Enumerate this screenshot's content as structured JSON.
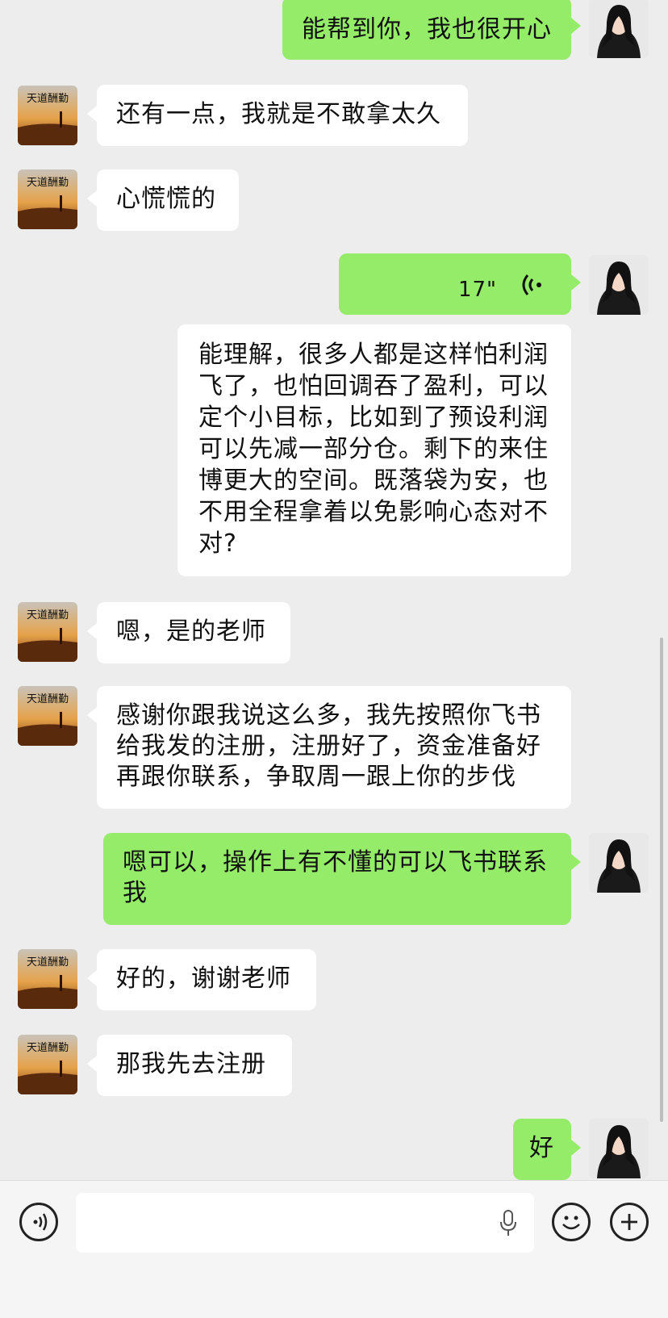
{
  "messages": [
    {
      "side": "right",
      "text": "能帮到你，我也很开心"
    },
    {
      "side": "left",
      "text": "还有一点，我就是不敢拿太久"
    },
    {
      "side": "left",
      "text": "心慌慌的"
    },
    {
      "side": "right",
      "type": "voice",
      "duration": "17\""
    },
    {
      "side": "right",
      "text": "能理解，很多人都是这样怕利润飞了，也怕回调吞了盈利，可以定个小目标，比如到了预设利润可以先减一部分仓。剩下的来住博更大的空间。既落袋为安，也不用全程拿着以免影响心态对不对?"
    },
    {
      "side": "left",
      "text": "嗯，是的老师"
    },
    {
      "side": "left",
      "text": "感谢你跟我说这么多，我先按照你飞书给我发的注册，注册好了，资金准备好再跟你联系，争取周一跟上你的步伐"
    },
    {
      "side": "right",
      "text": "嗯可以，操作上有不懂的可以飞书联系我"
    },
    {
      "side": "left",
      "text": "好的，谢谢老师"
    },
    {
      "side": "left",
      "text": "那我先去注册"
    },
    {
      "side": "right",
      "text": "好"
    }
  ],
  "contact_avatar_text": "天道酬勤",
  "icons": {
    "voice_toggle": "voice-mode-icon",
    "mic": "microphone-icon",
    "emoji": "emoji-icon",
    "plus": "plus-icon"
  },
  "colors": {
    "background": "#ededed",
    "bubble_right": "#95ec69",
    "bubble_left": "#ffffff"
  }
}
